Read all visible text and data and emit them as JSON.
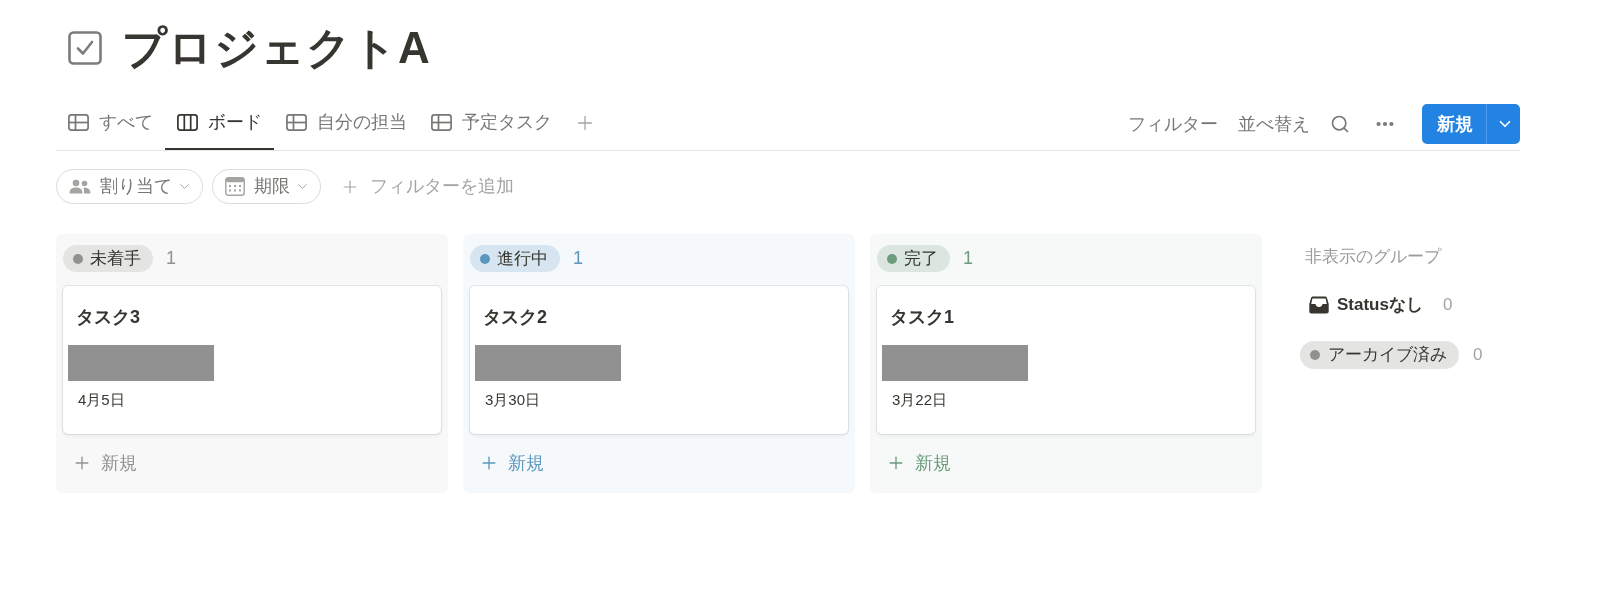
{
  "page": {
    "title": "プロジェクトA"
  },
  "tabs": [
    {
      "label": "すべて",
      "kind": "table",
      "selected": false
    },
    {
      "label": "ボード",
      "kind": "board",
      "selected": true
    },
    {
      "label": "自分の担当",
      "kind": "table",
      "selected": false
    },
    {
      "label": "予定タスク",
      "kind": "table",
      "selected": false
    }
  ],
  "toolbar": {
    "filter": "フィルター",
    "sort": "並べ替え",
    "new_button": "新規"
  },
  "filters": [
    {
      "label": "割り当て",
      "kind": "person"
    },
    {
      "label": "期限",
      "kind": "date"
    }
  ],
  "add_filter": "フィルターを追加",
  "columns": [
    {
      "status": "未着手",
      "color": "#91918e",
      "count": "1",
      "cards": [
        {
          "title": "タスク3",
          "date": "4月5日"
        }
      ],
      "new_label": "新規"
    },
    {
      "status": "進行中",
      "color": "#5b97bd",
      "count": "1",
      "cards": [
        {
          "title": "タスク2",
          "date": "3月30日"
        }
      ],
      "new_label": "新規"
    },
    {
      "status": "完了",
      "color": "#6c9b7d",
      "count": "1",
      "cards": [
        {
          "title": "タスク1",
          "date": "3月22日"
        }
      ],
      "new_label": "新規"
    }
  ],
  "hidden_groups": {
    "heading": "非表示のグループ",
    "items": [
      {
        "kind": "inbox",
        "label": "Statusなし",
        "count": "0"
      },
      {
        "kind": "tag",
        "label": "アーカイブ済み",
        "count": "0",
        "color": "#91918e"
      }
    ]
  }
}
